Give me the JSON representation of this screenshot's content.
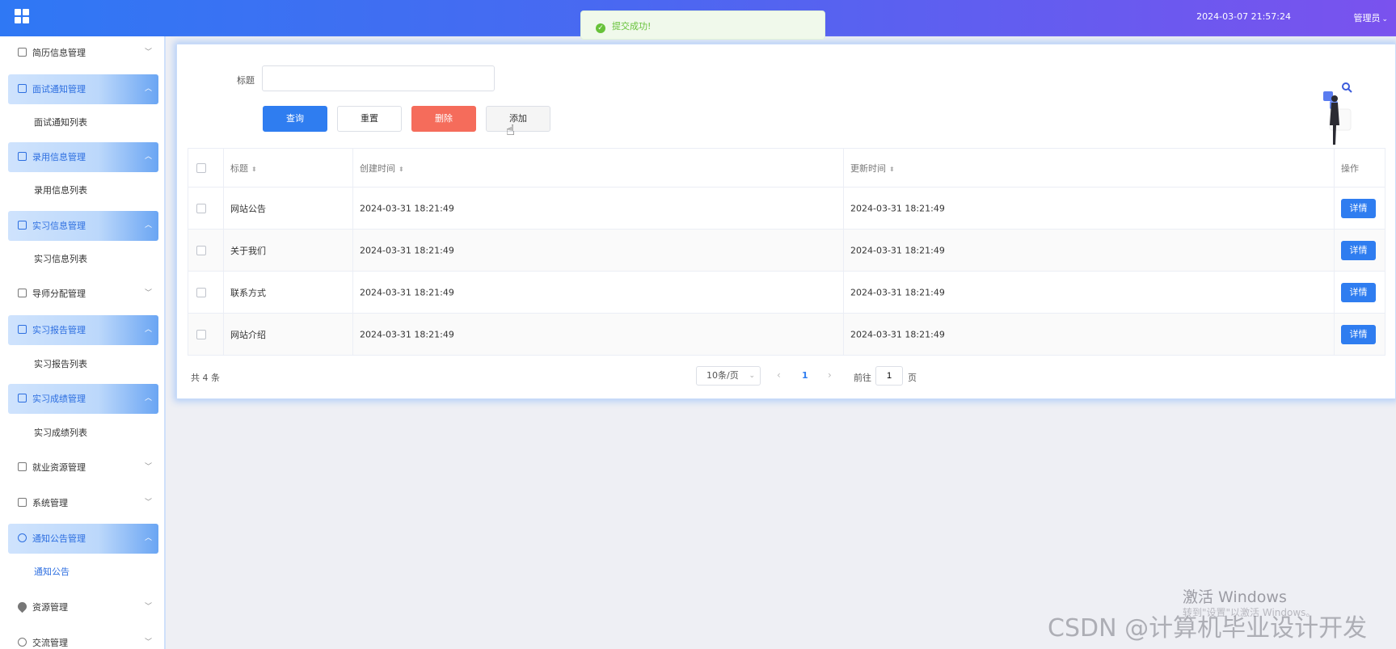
{
  "header": {
    "datetime": "2024-03-07 21:57:24",
    "user": "管理员",
    "gradient": [
      "#2f78f4",
      "#7a52ee"
    ]
  },
  "toast": {
    "message": "提交成功!",
    "type": "success",
    "color": "#67c23a"
  },
  "sidebar": {
    "items": [
      {
        "label": "简历信息管理",
        "open": false,
        "icon": "document-icon"
      },
      {
        "label": "面试通知管理",
        "open": true,
        "icon": "document-icon",
        "sub": "面试通知列表"
      },
      {
        "label": "录用信息管理",
        "open": true,
        "icon": "document-icon",
        "sub": "录用信息列表"
      },
      {
        "label": "实习信息管理",
        "open": true,
        "icon": "document-icon",
        "sub": "实习信息列表"
      },
      {
        "label": "导师分配管理",
        "open": false,
        "icon": "document-icon"
      },
      {
        "label": "实习报告管理",
        "open": true,
        "icon": "document-icon",
        "sub": "实习报告列表"
      },
      {
        "label": "实习成绩管理",
        "open": true,
        "icon": "document-icon",
        "sub": "实习成绩列表"
      },
      {
        "label": "就业资源管理",
        "open": false,
        "icon": "document-icon"
      },
      {
        "label": "系统管理",
        "open": false,
        "icon": "picture-icon"
      },
      {
        "label": "通知公告管理",
        "open": true,
        "icon": "info-circle-icon",
        "sub": "通知公告",
        "sub_active": true
      },
      {
        "label": "资源管理",
        "open": false,
        "icon": "pin-icon"
      },
      {
        "label": "交流管理",
        "open": false,
        "icon": "chat-icon"
      }
    ]
  },
  "filter": {
    "title_label": "标题",
    "title_value": "",
    "buttons": {
      "search": "查询",
      "reset": "重置",
      "delete": "删除",
      "add": "添加"
    }
  },
  "table": {
    "headers": {
      "title": "标题",
      "created": "创建时间",
      "updated": "更新时间",
      "action": "操作"
    },
    "rows": [
      {
        "title": "网站公告",
        "created": "2024-03-31 18:21:49",
        "updated": "2024-03-31 18:21:49",
        "action": "详情"
      },
      {
        "title": "关于我们",
        "created": "2024-03-31 18:21:49",
        "updated": "2024-03-31 18:21:49",
        "action": "详情"
      },
      {
        "title": "联系方式",
        "created": "2024-03-31 18:21:49",
        "updated": "2024-03-31 18:21:49",
        "action": "详情"
      },
      {
        "title": "网站介绍",
        "created": "2024-03-31 18:21:49",
        "updated": "2024-03-31 18:21:49",
        "action": "详情"
      }
    ]
  },
  "pagination": {
    "total": "共 4 条",
    "page_size": "10条/页",
    "current_page": "1",
    "goto_label": "前往",
    "goto_value": "1",
    "goto_suffix": "页"
  },
  "watermarks": {
    "windows_title": "激活 Windows",
    "windows_sub": "转到\"设置\"以激活 Windows。",
    "csdn": "CSDN @计算机毕业设计开发"
  }
}
